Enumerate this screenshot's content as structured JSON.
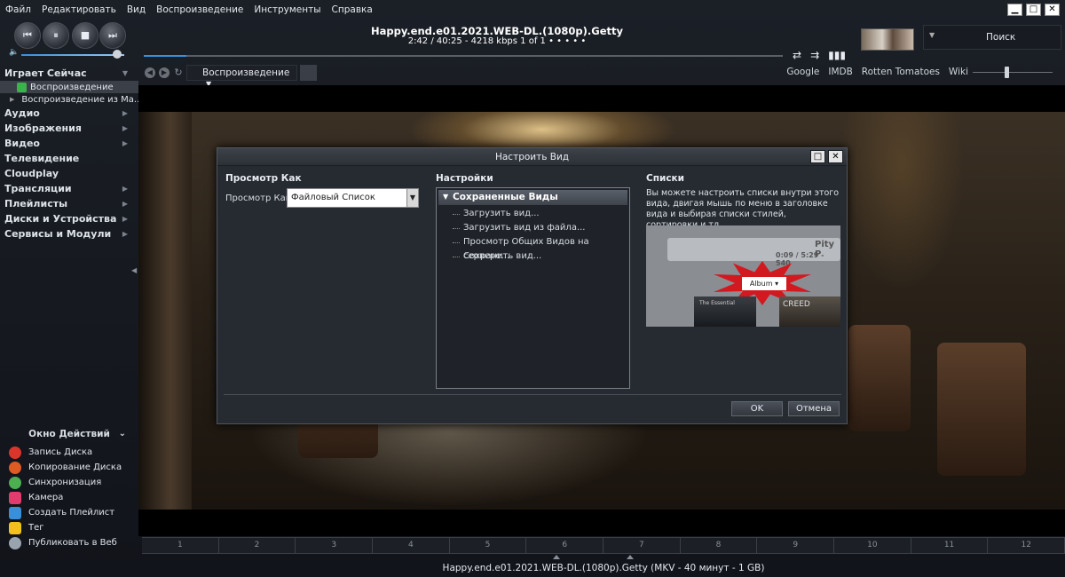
{
  "menu": [
    "Файл",
    "Редактировать",
    "Вид",
    "Воспроизведение",
    "Инструменты",
    "Справка"
  ],
  "window_controls": {
    "minimize": "▁",
    "maximize": "□",
    "close": "✕"
  },
  "player": {
    "title": "Happy.end.e01.2021.WEB-DL.(1080p).Getty",
    "info": "2:42 / 40:25 - 4218 kbps   1 of 1   •  •  •  •  •",
    "progress_fraction": 0.067,
    "volume_fraction": 0.9
  },
  "search": {
    "label": "Поиск"
  },
  "sidebar": {
    "now_playing": "Играет Сейчас",
    "now_items": [
      "Воспроизведение",
      "Воспроизведение из Ма..."
    ],
    "sections": [
      "Аудио",
      "Изображения",
      "Видео",
      "Телевидение",
      "Cloudplay",
      "Трансляции",
      "Плейлисты",
      "Диски и Устройства",
      "Сервисы и Модули"
    ]
  },
  "actions": {
    "header": "Окно Действий",
    "items": [
      "Запись Диска",
      "Копирование Диска",
      "Синхронизация",
      "Камера",
      "Создать Плейлист",
      "Тег",
      "Публиковать в Веб"
    ]
  },
  "nav": {
    "dropdown": "Воспроизведение",
    "links": [
      "Google",
      "IMDB",
      "Rotten Tomatoes",
      "Wiki"
    ]
  },
  "dialog": {
    "title": "Настроить Вид",
    "col1_header": "Просмотр Как",
    "view_label": "Просмотр Как:",
    "view_value": "Файловый Список",
    "col2_header": "Настройки",
    "tree_header": "Сохраненные Виды",
    "tree_items": [
      "Загрузить вид...",
      "Загрузить вид из файла...",
      "Просмотр Общих Видов на сервере...",
      "Сохранить вид..."
    ],
    "col3_header": "Списки",
    "description": "Вы можете настроить списки внутри этого вида, двигая мышь по меню в заголовке вида и выбирая списки стилей, сортировки и тд.",
    "preview": {
      "artist": "Pity P",
      "time": "0:09 / 5:29 - 540",
      "album": "Album ▾",
      "cover1": "The Essential",
      "cover2": "CREED"
    },
    "ok": "OK",
    "cancel": "Отмена"
  },
  "timeline": [
    "1",
    "2",
    "3",
    "4",
    "5",
    "6",
    "7",
    "8",
    "9",
    "10",
    "11",
    "12"
  ],
  "status": "Happy.end.e01.2021.WEB-DL.(1080p).Getty (MKV - 40 минут - 1 GB)"
}
